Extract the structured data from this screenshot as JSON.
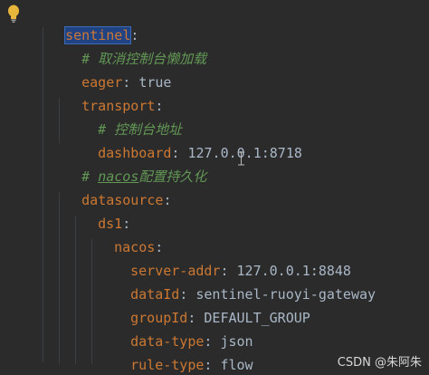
{
  "editor": {
    "lines": [
      {
        "key": "sentinel",
        "sep": ":",
        "value": ""
      },
      {
        "comment": "# 取消控制台懒加载"
      },
      {
        "key": "eager",
        "sep": ": ",
        "value": "true"
      },
      {
        "key": "transport",
        "sep": ":",
        "value": ""
      },
      {
        "comment": "# 控制台地址"
      },
      {
        "key": "dashboard",
        "sep": ": ",
        "value": "127.0.0.1:8718"
      },
      {
        "comment_prefix": "# ",
        "comment_underlined": "nacos",
        "comment_rest": "配置持久化"
      },
      {
        "key": "datasource",
        "sep": ":",
        "value": ""
      },
      {
        "key": "ds1",
        "sep": ":",
        "value": ""
      },
      {
        "key": "nacos",
        "sep": ":",
        "value": ""
      },
      {
        "key": "server-addr",
        "sep": ": ",
        "value": "127.0.0.1:8848"
      },
      {
        "key": "dataId",
        "sep": ": ",
        "value": "sentinel-ruoyi-gateway"
      },
      {
        "key": "groupId",
        "sep": ": ",
        "value": "DEFAULT_GROUP"
      },
      {
        "key": "data-type",
        "sep": ": ",
        "value": "json"
      },
      {
        "key": "rule-type",
        "sep": ": ",
        "value": "flow"
      }
    ],
    "colors": {
      "background": "#2b2b2b",
      "key": "#cc7832",
      "value": "#a9b7c6",
      "comment": "#629755",
      "selection": "#214283"
    }
  },
  "icons": {
    "bulb": "lightbulb-icon",
    "caret": "text-cursor-icon"
  },
  "watermark": "CSDN @朱阿朱"
}
